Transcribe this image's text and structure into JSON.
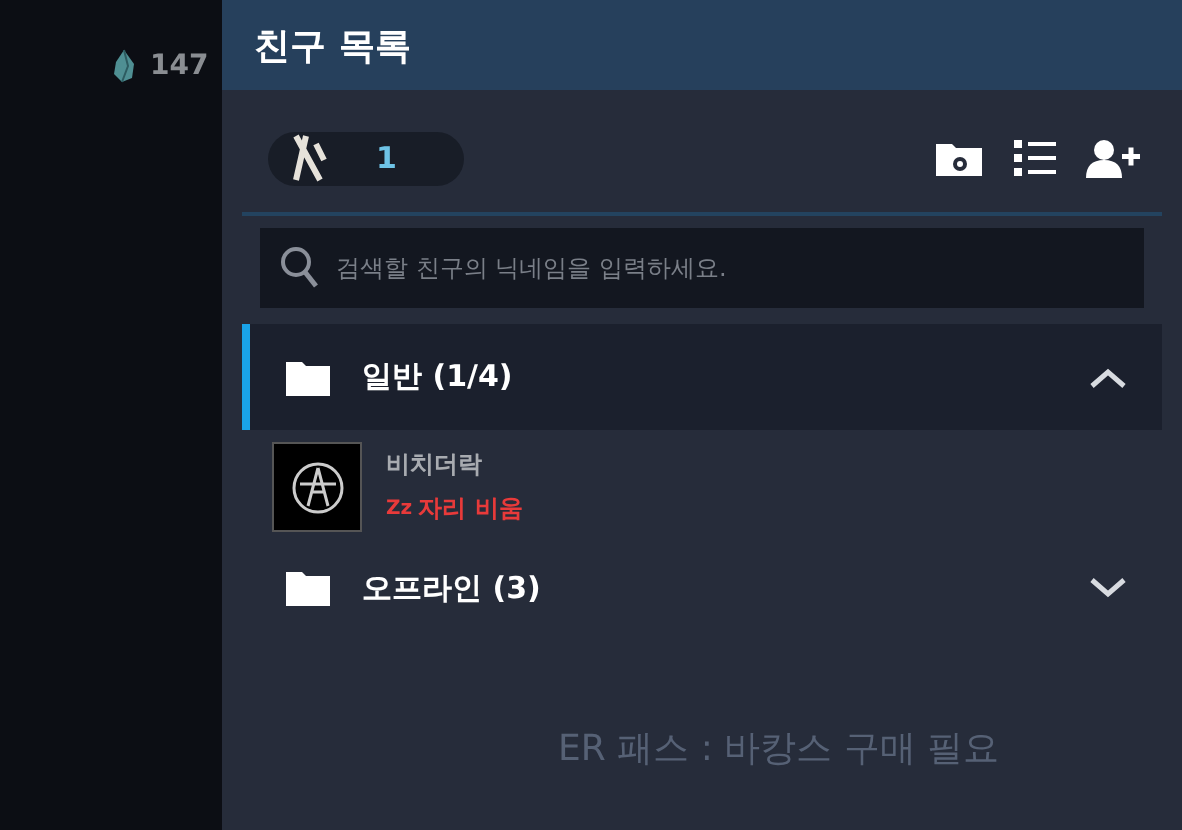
{
  "currency": {
    "amount": "147"
  },
  "window": {
    "title": "친구 목록"
  },
  "friend_count": "1",
  "search": {
    "placeholder": "검색할 친구의 닉네임을 입력하세요."
  },
  "groups": [
    {
      "name": "일반 (1/4)",
      "selected": true,
      "expanded": true,
      "friends": [
        {
          "name": "비치더락",
          "status_mark": "Zz",
          "status": "자리 비움",
          "kind": "away"
        }
      ]
    },
    {
      "name": "오프라인 (3)",
      "selected": false,
      "expanded": false
    }
  ],
  "background_text": "ER 패스 : 바캉스 구매 필요"
}
